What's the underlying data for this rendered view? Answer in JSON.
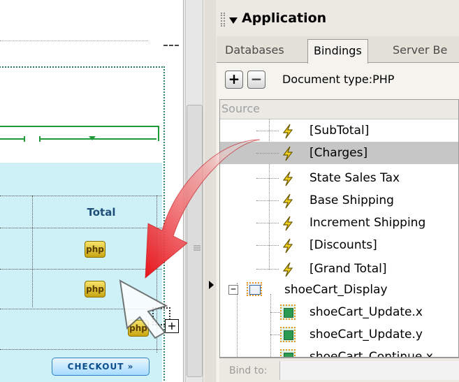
{
  "design": {
    "total_header": "Total",
    "php_badge": "php",
    "checkout_label": "CHECKOUT",
    "checkout_chevron": "»",
    "drop_plus": "+"
  },
  "panel": {
    "title": "Application",
    "tabs": [
      {
        "label": "Databases",
        "active": false
      },
      {
        "label": "Bindings",
        "active": true
      },
      {
        "label": "Server Be",
        "active": false
      }
    ],
    "toolbar": {
      "add_label": "+",
      "remove_label": "−",
      "document_type": "Document type:PHP"
    },
    "tree": {
      "column_header": "Source",
      "items": [
        {
          "label": "[SubTotal]",
          "icon": "lightning-bolt-icon",
          "selected": false
        },
        {
          "label": "[Charges]",
          "icon": "lightning-bolt-icon",
          "selected": true
        },
        {
          "label": "State Sales Tax",
          "icon": "lightning-bolt-icon",
          "selected": false
        },
        {
          "label": "Base Shipping",
          "icon": "lightning-bolt-icon",
          "selected": false
        },
        {
          "label": "Increment Shipping",
          "icon": "lightning-bolt-icon",
          "selected": false
        },
        {
          "label": "[Discounts]",
          "icon": "lightning-bolt-icon",
          "selected": false
        },
        {
          "label": "[Grand Total]",
          "icon": "lightning-bolt-icon",
          "selected": false
        }
      ],
      "group": {
        "label": "shoeCart_Display",
        "expander": "−",
        "icon": "recordset-icon"
      },
      "group_items": [
        {
          "label": "shoeCart_Update.x",
          "icon": "form-element-icon"
        },
        {
          "label": "shoeCart_Update.y",
          "icon": "form-element-icon"
        },
        {
          "label": "shoeCart_Continue.x",
          "icon": "form-element-icon"
        }
      ]
    },
    "bind_label": "Bind to:"
  },
  "colors": {
    "arrow_red": "#e8141b",
    "cyan_cell": "#cdf1f7",
    "ruler_green": "#1f9a3a",
    "selected_row": "#c6c6c6"
  }
}
